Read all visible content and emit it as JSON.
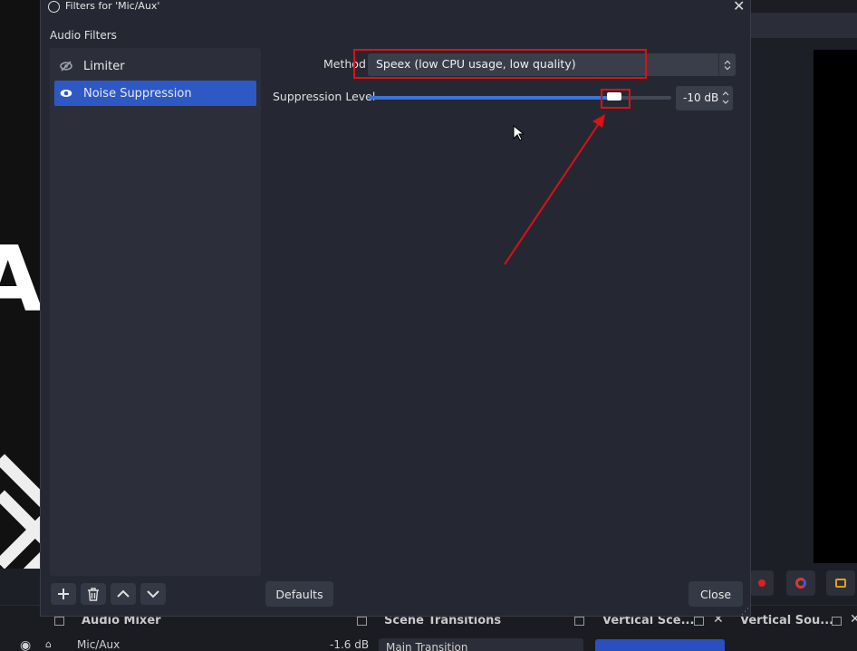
{
  "dialog": {
    "title": "Filters for 'Mic/Aux'",
    "section_label": "Audio Filters",
    "filters": [
      {
        "name": "Limiter",
        "enabled": false,
        "selected": false
      },
      {
        "name": "Noise Suppression",
        "enabled": true,
        "selected": true
      }
    ],
    "properties": {
      "method_label": "Method",
      "method_value": "Speex (low CPU usage, low quality)",
      "suppression_label": "Suppression Level",
      "suppression_value": "-10 dB",
      "suppression_fraction": 0.81
    },
    "buttons": {
      "defaults": "Defaults",
      "close": "Close"
    }
  },
  "background_docks": {
    "audio_mixer": {
      "title": "Audio Mixer",
      "source": "Mic/Aux",
      "level": "-1.6 dB"
    },
    "scene_transitions": {
      "title": "Scene Transitions",
      "transition": "Main Transition"
    },
    "vertical_scenes": {
      "title": "Vertical Sce..."
    },
    "vertical_sources": {
      "title": "Vertical Sou..."
    }
  },
  "colors": {
    "selected_item": "#2e59c4",
    "slider_fill": "#3a74d8",
    "annotation_red": "#e01010"
  },
  "icons": [
    "eye-icon",
    "eye-slash-icon",
    "plus-icon",
    "trash-icon",
    "chevron-up-icon",
    "chevron-down-icon",
    "close-icon",
    "obs-logo-icon"
  ]
}
